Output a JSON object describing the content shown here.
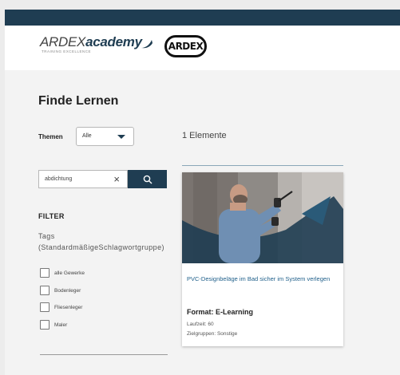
{
  "brand": {
    "academy_prefix": "ARDEX",
    "academy_suffix": "academy",
    "academy_tagline": "TRAINING EXCELLENCE",
    "ardex_logo": "ARDEX",
    "colors": {
      "dark_blue": "#1f3d52",
      "link_blue": "#1f5f8a"
    }
  },
  "page": {
    "title": "Finde Lernen"
  },
  "filters": {
    "themen_label": "Themen",
    "themen_selected": "Alle",
    "search_value": "abdichtung",
    "filter_heading": "FILTER",
    "tags_title": "Tags (StandardmäßigeSchlagwortgruppe)",
    "checkboxes": [
      "alle Gewerke",
      "Bodenleger",
      "Fliesenleger",
      "Maler"
    ]
  },
  "results": {
    "count_text": "1 Elemente",
    "card": {
      "title": "PVC-Designbeläge im Bad sicher im System verlegen",
      "format": "Format: E-Learning",
      "laufzeit": "Laufzeit: 60",
      "zielgruppen": "Zielgruppen: Sonstige"
    }
  },
  "icons": {
    "search": "search-icon",
    "clear": "close-icon",
    "dropdown": "chevron-down-icon"
  }
}
